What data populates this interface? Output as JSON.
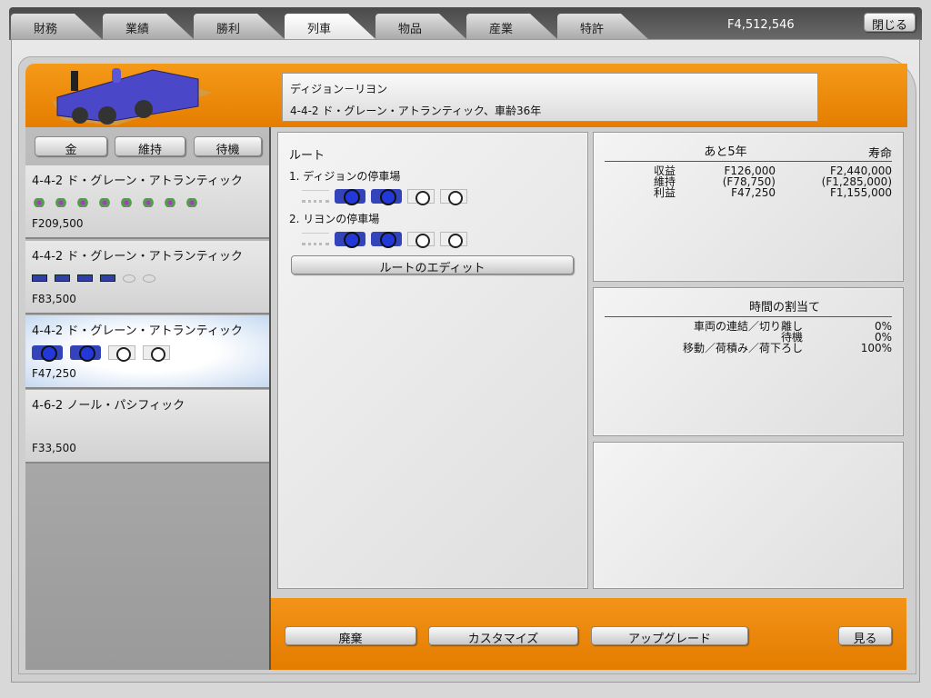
{
  "tabs": [
    {
      "label": "財務"
    },
    {
      "label": "業績"
    },
    {
      "label": "勝利"
    },
    {
      "label": "列車",
      "active": true
    },
    {
      "label": "物品"
    },
    {
      "label": "産業"
    },
    {
      "label": "特許"
    }
  ],
  "money": "F4,512,546",
  "close_label": "閉じる",
  "header": {
    "route": "ディジョン－リヨン",
    "train": "4-4-2 ド・グレーン・アトランティック、車齢36年"
  },
  "left_buttons": {
    "money": "金",
    "maintenance": "維持",
    "standby": "待機"
  },
  "trains": [
    {
      "name": "4-4-2 ド・グレーン・アトランティック",
      "price": "F209,500",
      "cars": "green8"
    },
    {
      "name": "4-4-2 ド・グレーン・アトランティック",
      "price": "F83,500",
      "cars": "blue4empty2"
    },
    {
      "name": "4-4-2 ド・グレーン・アトランティック",
      "price": "F47,250",
      "cars": "blue2empty2",
      "selected": true
    },
    {
      "name": "4-6-2 ノール・パシフィック",
      "price": "F33,500",
      "cars": "none"
    }
  ],
  "route": {
    "title": "ルート",
    "stops": [
      "1. ディジョンの停車場",
      "2. リヨンの停車場"
    ],
    "edit_label": "ルートのエディット"
  },
  "finance": {
    "col1": "あと5年",
    "col2": "寿命",
    "rows": [
      {
        "label": "収益",
        "v1": "F126,000",
        "v2": "F2,440,000"
      },
      {
        "label": "維持",
        "v1": "(F78,750)",
        "v2": "(F1,285,000)"
      },
      {
        "label": "利益",
        "v1": "F47,250",
        "v2": "F1,155,000"
      }
    ]
  },
  "time": {
    "title": "時間の割当て",
    "rows": [
      {
        "label": "車両の連結／切り離し",
        "value": "0%"
      },
      {
        "label": "待機",
        "value": "0%"
      },
      {
        "label": "移動／荷積み／荷下ろし",
        "value": "100%"
      }
    ]
  },
  "bottom": {
    "scrap": "廃棄",
    "customize": "カスタマイズ",
    "upgrade": "アップグレード",
    "view": "見る"
  }
}
